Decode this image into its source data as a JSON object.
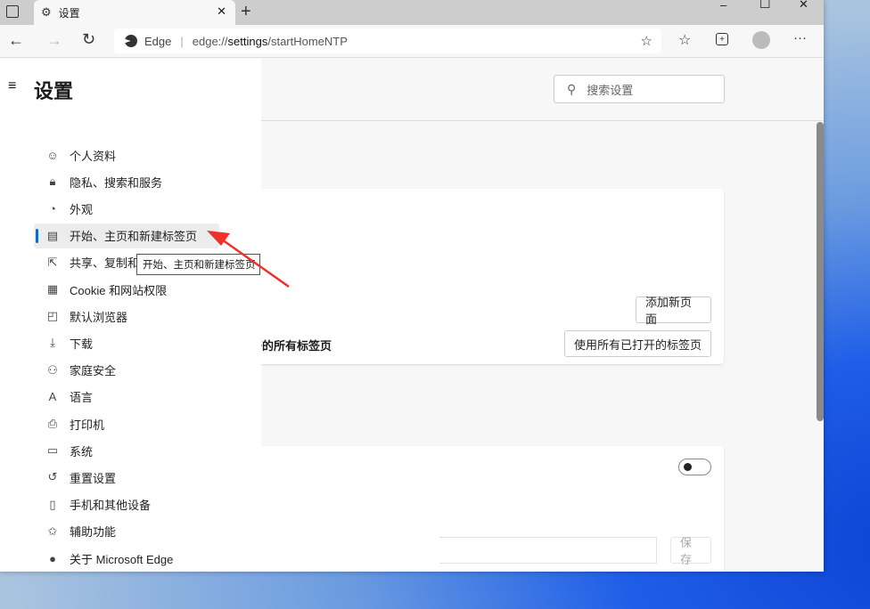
{
  "browser": {
    "tab_title": "设置",
    "address_brand": "Edge",
    "url_prefix": "edge://",
    "url_host": "settings",
    "url_path": "/startHomeNTP"
  },
  "window_controls": {
    "minimize": "–",
    "maximize": "☐",
    "close": "✕"
  },
  "sidebar": {
    "title": "设置",
    "items": [
      {
        "label": "个人资料",
        "icon": "profile-icon"
      },
      {
        "label": "隐私、搜索和服务",
        "icon": "lock-icon"
      },
      {
        "label": "外观",
        "icon": "palette-icon"
      },
      {
        "label": "开始、主页和新建标签页",
        "icon": "home-tab-icon",
        "active": true
      },
      {
        "label": "共享、复制和粘贴",
        "icon": "share-icon"
      },
      {
        "label": "Cookie 和网站权限",
        "icon": "cookie-icon"
      },
      {
        "label": "默认浏览器",
        "icon": "browser-icon"
      },
      {
        "label": "下载",
        "icon": "download-icon"
      },
      {
        "label": "家庭安全",
        "icon": "family-icon"
      },
      {
        "label": "语言",
        "icon": "language-icon"
      },
      {
        "label": "打印机",
        "icon": "printer-icon"
      },
      {
        "label": "系统",
        "icon": "laptop-icon"
      },
      {
        "label": "重置设置",
        "icon": "reset-icon"
      },
      {
        "label": "手机和其他设备",
        "icon": "phone-icon"
      },
      {
        "label": "辅助功能",
        "icon": "accessibility-icon"
      },
      {
        "label": "关于 Microsoft Edge",
        "icon": "edge-icon"
      }
    ]
  },
  "tooltip": "开始、主页和新建标签页",
  "search": {
    "placeholder": "搜索设置"
  },
  "main": {
    "open_tabs_text": "打开的所有标签页",
    "add_page_button": "添加新页面",
    "use_open_tabs_button": "使用所有已打开的标签页",
    "save_button": "保存",
    "toggle_on": false
  },
  "colors": {
    "accent": "#0f6cbd",
    "annotation_arrow": "#f0302a"
  }
}
